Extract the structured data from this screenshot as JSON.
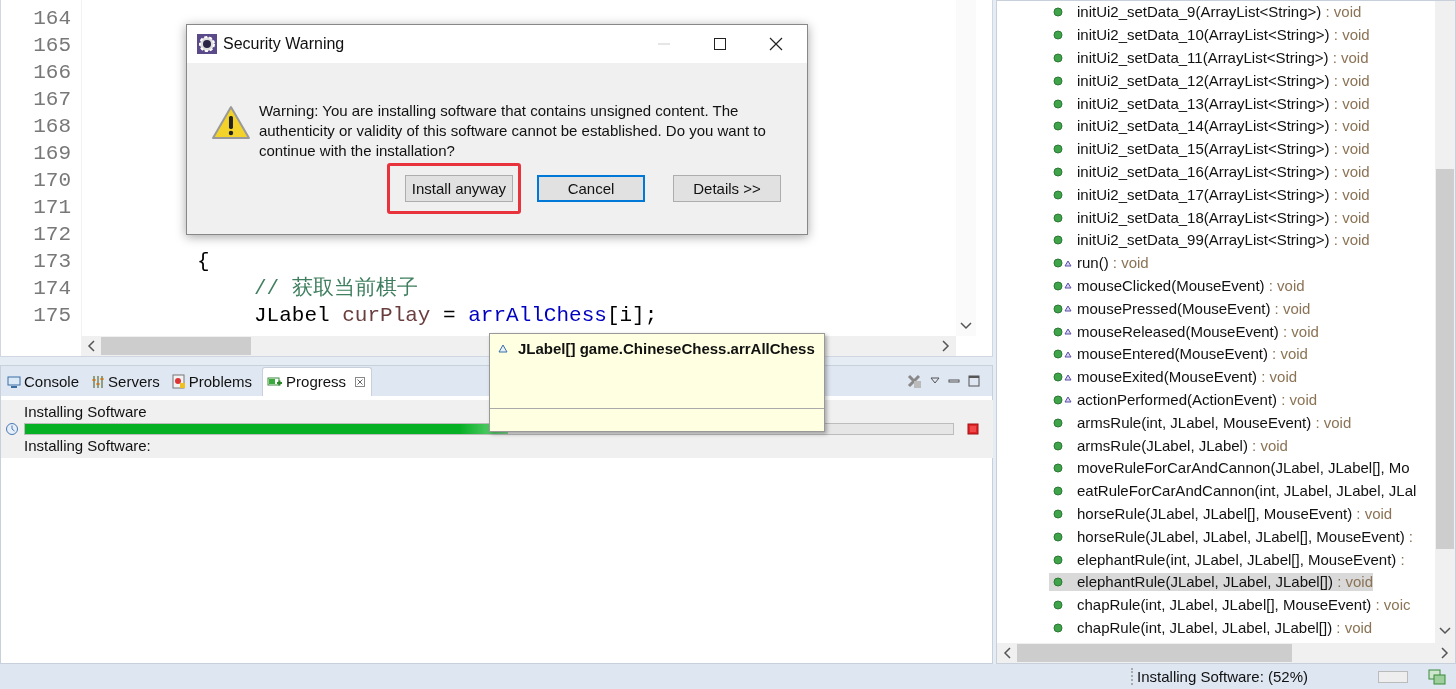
{
  "editor": {
    "lines": [
      {
        "number": "164"
      },
      {
        "number": "165"
      },
      {
        "number": "166"
      },
      {
        "number": "167"
      },
      {
        "number": "168"
      },
      {
        "number": "169"
      },
      {
        "number": "170"
      },
      {
        "number": "171"
      },
      {
        "number": "172"
      },
      {
        "number": "173",
        "kind": "outer",
        "segments": [
          {
            "kind": "plain",
            "text": "{"
          }
        ]
      },
      {
        "number": "174",
        "kind": "inner",
        "segments": [
          {
            "kind": "comment",
            "text": "// 获取当前棋子"
          }
        ]
      },
      {
        "number": "175",
        "kind": "inner",
        "segments": [
          {
            "kind": "plain",
            "text": "JLabel "
          },
          {
            "kind": "local",
            "text": "curPlay"
          },
          {
            "kind": "plain",
            "text": " = "
          },
          {
            "kind": "field",
            "text": "arrAllChess"
          },
          {
            "kind": "plain",
            "text": "[i];"
          }
        ]
      }
    ]
  },
  "dialog": {
    "title": "Security Warning",
    "message": "Warning: You are installing software that contains unsigned content. The authenticity or validity of this software cannot be established. Do you want to continue with the installation?",
    "buttons": [
      {
        "label": "Install anyway",
        "default": false,
        "highlighted": true
      },
      {
        "label": "Cancel",
        "default": true,
        "highlighted": false
      },
      {
        "label": "Details >>",
        "default": false,
        "highlighted": false
      }
    ]
  },
  "tooltip": {
    "text": "JLabel[] game.ChineseChess.arrAllChess"
  },
  "bottom_panel": {
    "tabs": [
      {
        "label": "Console",
        "selected": false,
        "closable": false
      },
      {
        "label": "Servers",
        "selected": false,
        "closable": false
      },
      {
        "label": "Problems",
        "selected": false,
        "closable": false
      },
      {
        "label": "Progress",
        "selected": true,
        "closable": true
      }
    ],
    "job": {
      "title": "Installing Software",
      "level": 0.52,
      "detail": "Installing Software:"
    }
  },
  "outline": {
    "items": [
      {
        "kind": "public",
        "signature": "initUi2_setData_9(ArrayList<String>)",
        "return_type": " : void",
        "selected": false
      },
      {
        "kind": "public",
        "signature": "initUi2_setData_10(ArrayList<String>)",
        "return_type": " : void",
        "selected": false
      },
      {
        "kind": "public",
        "signature": "initUi2_setData_11(ArrayList<String>)",
        "return_type": " : void",
        "selected": false
      },
      {
        "kind": "public",
        "signature": "initUi2_setData_12(ArrayList<String>)",
        "return_type": " : void",
        "selected": false
      },
      {
        "kind": "public",
        "signature": "initUi2_setData_13(ArrayList<String>)",
        "return_type": " : void",
        "selected": false
      },
      {
        "kind": "public",
        "signature": "initUi2_setData_14(ArrayList<String>)",
        "return_type": " : void",
        "selected": false
      },
      {
        "kind": "public",
        "signature": "initUi2_setData_15(ArrayList<String>)",
        "return_type": " : void",
        "selected": false
      },
      {
        "kind": "public",
        "signature": "initUi2_setData_16(ArrayList<String>)",
        "return_type": " : void",
        "selected": false
      },
      {
        "kind": "public",
        "signature": "initUi2_setData_17(ArrayList<String>)",
        "return_type": " : void",
        "selected": false
      },
      {
        "kind": "public",
        "signature": "initUi2_setData_18(ArrayList<String>)",
        "return_type": " : void",
        "selected": false
      },
      {
        "kind": "public",
        "signature": "initUi2_setData_99(ArrayList<String>)",
        "return_type": " : void",
        "selected": false
      },
      {
        "kind": "override",
        "signature": "run()",
        "return_type": " : void",
        "selected": false
      },
      {
        "kind": "override",
        "signature": "mouseClicked(MouseEvent)",
        "return_type": " : void",
        "selected": false
      },
      {
        "kind": "override",
        "signature": "mousePressed(MouseEvent)",
        "return_type": " : void",
        "selected": false
      },
      {
        "kind": "override",
        "signature": "mouseReleased(MouseEvent)",
        "return_type": " : void",
        "selected": false
      },
      {
        "kind": "override",
        "signature": "mouseEntered(MouseEvent)",
        "return_type": " : void",
        "selected": false
      },
      {
        "kind": "override",
        "signature": "mouseExited(MouseEvent)",
        "return_type": " : void",
        "selected": false
      },
      {
        "kind": "override",
        "signature": "actionPerformed(ActionEvent)",
        "return_type": " : void",
        "selected": false
      },
      {
        "kind": "public",
        "signature": "armsRule(int, JLabel, MouseEvent)",
        "return_type": " : void",
        "selected": false
      },
      {
        "kind": "public",
        "signature": "armsRule(JLabel, JLabel)",
        "return_type": " : void",
        "selected": false
      },
      {
        "kind": "public",
        "signature": "moveRuleForCarAndCannon(JLabel, JLabel[], Mo",
        "selected": false
      },
      {
        "kind": "public",
        "signature": "eatRuleForCarAndCannon(int, JLabel, JLabel, JLal",
        "selected": false
      },
      {
        "kind": "public",
        "signature": "horseRule(JLabel, JLabel[], MouseEvent)",
        "return_type": " : void",
        "selected": false
      },
      {
        "kind": "public",
        "signature": "horseRule(JLabel, JLabel, JLabel[], MouseEvent)",
        "return_type": " :",
        "selected": false
      },
      {
        "kind": "public",
        "signature": "elephantRule(int, JLabel, JLabel[], MouseEvent)",
        "return_type": " :",
        "selected": false
      },
      {
        "kind": "public",
        "signature": "elephantRule(JLabel, JLabel, JLabel[])",
        "return_type": " : void",
        "selected": true
      },
      {
        "kind": "public",
        "signature": "chapRule(int, JLabel, JLabel[], MouseEvent)",
        "return_type": " : voic",
        "selected": false
      },
      {
        "kind": "public",
        "signature": "chapRule(int, JLabel, JLabel, JLabel[])",
        "return_type": " : void",
        "selected": false
      }
    ]
  },
  "status_bar": {
    "text": "Installing Software: (52%)"
  }
}
